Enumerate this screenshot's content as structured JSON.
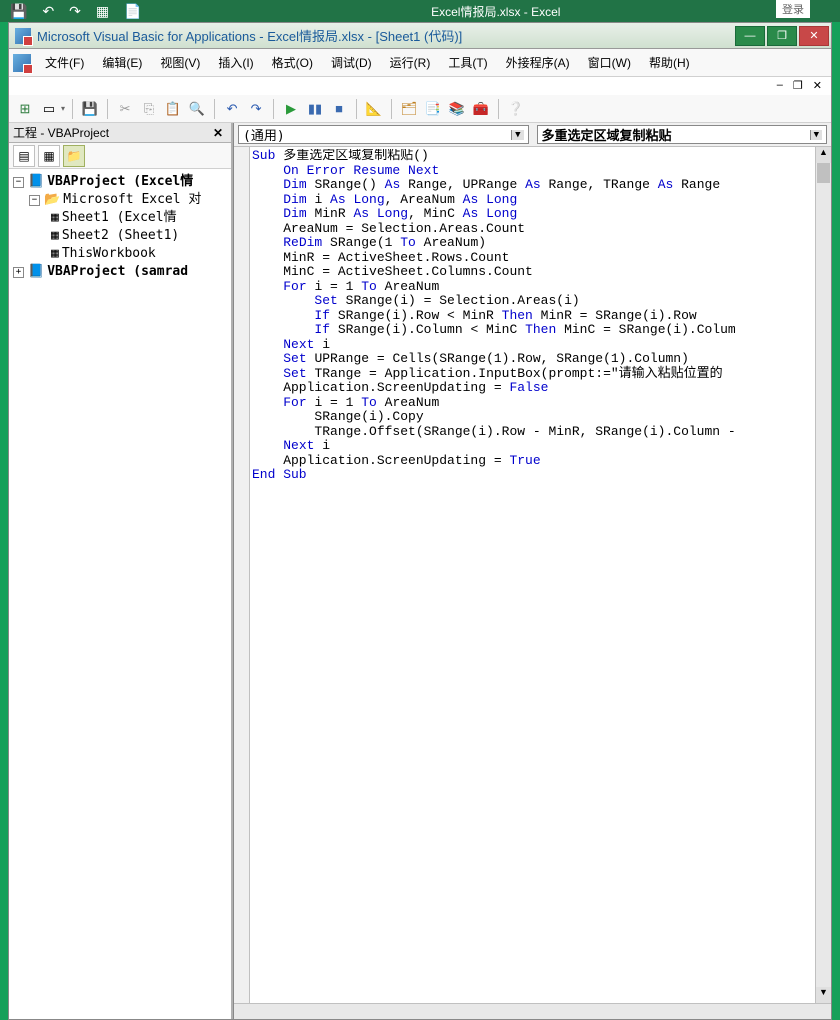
{
  "excel_header": {
    "title": "Excel情报局.xlsx - Excel",
    "login": "登录"
  },
  "titlebar": {
    "title": "Microsoft Visual Basic for Applications - Excel情报局.xlsx - [Sheet1 (代码)]"
  },
  "menu": {
    "file": "文件(F)",
    "edit": "编辑(E)",
    "view": "视图(V)",
    "insert": "插入(I)",
    "format": "格式(O)",
    "debug": "调试(D)",
    "run": "运行(R)",
    "tools": "工具(T)",
    "addins": "外接程序(A)",
    "window": "窗口(W)",
    "help": "帮助(H)"
  },
  "project_panel": {
    "title": "工程 - VBAProject",
    "nodes": {
      "p1": "VBAProject (Excel情",
      "p1f": "Microsoft Excel 对",
      "s1": "Sheet1 (Excel情",
      "s2": "Sheet2 (Sheet1)",
      "tw": "ThisWorkbook",
      "p2": "VBAProject (samrad"
    }
  },
  "code_dropdowns": {
    "left": "(通用)",
    "right": "多重选定区域复制粘贴"
  },
  "code": {
    "l01a": "Sub ",
    "l01b": "多重选定区域复制粘贴()",
    "l02a": "    ",
    "l02b": "On Error Resume Next",
    "l03a": "    ",
    "l03b": "Dim ",
    "l03c": "SRange() ",
    "l03d": "As ",
    "l03e": "Range, UPRange ",
    "l03f": "As ",
    "l03g": "Range, TRange ",
    "l03h": "As ",
    "l03i": "Range",
    "l04a": "    ",
    "l04b": "Dim ",
    "l04c": "i ",
    "l04d": "As Long",
    "l04e": ", AreaNum ",
    "l04f": "As Long",
    "l05a": "    ",
    "l05b": "Dim ",
    "l05c": "MinR ",
    "l05d": "As Long",
    "l05e": ", MinC ",
    "l05f": "As Long",
    "l06": "    AreaNum = Selection.Areas.Count",
    "l07a": "    ",
    "l07b": "ReDim ",
    "l07c": "SRange(1 ",
    "l07d": "To ",
    "l07e": "AreaNum)",
    "l08": "    MinR = ActiveSheet.Rows.Count",
    "l09": "    MinC = ActiveSheet.Columns.Count",
    "l10a": "    ",
    "l10b": "For ",
    "l10c": "i = 1 ",
    "l10d": "To ",
    "l10e": "AreaNum",
    "l11a": "        ",
    "l11b": "Set ",
    "l11c": "SRange(i) = Selection.Areas(i)",
    "l12a": "        ",
    "l12b": "If ",
    "l12c": "SRange(i).Row < MinR ",
    "l12d": "Then ",
    "l12e": "MinR = SRange(i).Row",
    "l13a": "        ",
    "l13b": "If ",
    "l13c": "SRange(i).Column < MinC ",
    "l13d": "Then ",
    "l13e": "MinC = SRange(i).Colum",
    "l14a": "    ",
    "l14b": "Next ",
    "l14c": "i",
    "l15a": "    ",
    "l15b": "Set ",
    "l15c": "UPRange = Cells(SRange(1).Row, SRange(1).Column)",
    "l16a": "    ",
    "l16b": "Set ",
    "l16c": "TRange = Application.InputBox(prompt:=\"请输入粘贴位置的",
    "l17a": "    Application.ScreenUpdating = ",
    "l17b": "False",
    "l18a": "    ",
    "l18b": "For ",
    "l18c": "i = 1 ",
    "l18d": "To ",
    "l18e": "AreaNum",
    "l19": "        SRange(i).Copy",
    "l20": "        TRange.Offset(SRange(i).Row - MinR, SRange(i).Column -",
    "l21a": "    ",
    "l21b": "Next ",
    "l21c": "i",
    "l22a": "    Application.ScreenUpdating = ",
    "l22b": "True",
    "l23": "End Sub"
  }
}
